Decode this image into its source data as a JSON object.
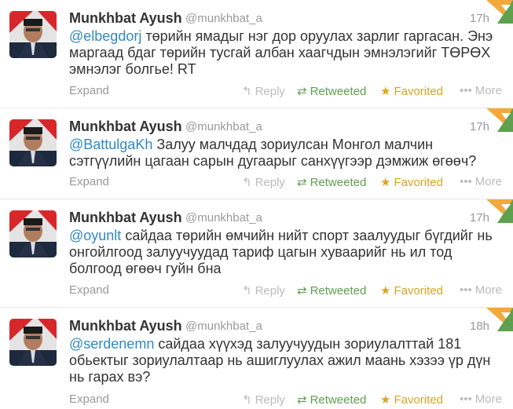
{
  "tweets": [
    {
      "name": "Munkhbat Ayush",
      "handle": "@munkhbat_a",
      "time": "17h",
      "mention": "@elbegdorj",
      "lines": [
        " төрийн ямадыг нэг дор оруулах зарлиг гаргасан. Энэ",
        "маргаад бдаг төрийн тусгай албан хаагчдын эмнэлэгийг ТӨРӨХ",
        "эмнэлэг болгье! RT"
      ],
      "expand": "Expand",
      "reply": "Reply",
      "retweet": "Retweeted",
      "favorite": "Favorited",
      "more": "More"
    },
    {
      "name": "Munkhbat Ayush",
      "handle": "@munkhbat_a",
      "time": "17h",
      "mention": "@BattulgaKh",
      "lines": [
        " Залуу малчдад зориулсан Монгол малчин",
        "сэтгүүлийн цагаан сарын дугаарыг санхүүгээр дэмжиж өгөөч?"
      ],
      "expand": "Expand",
      "reply": "Reply",
      "retweet": "Retweeted",
      "favorite": "Favorited",
      "more": "More"
    },
    {
      "name": "Munkhbat Ayush",
      "handle": "@munkhbat_a",
      "time": "17h",
      "mention": "@oyunlt",
      "lines": [
        " сайдаа төрийн өмчийн нийт спорт заалуудыг бүгдийг нь",
        "онгойлгоод залуучуудад тариф цагын хуваарийг нь ил тод",
        "болгоод өгөөч гуйн бна"
      ],
      "expand": "Expand",
      "reply": "Reply",
      "retweet": "Retweeted",
      "favorite": "Favorited",
      "more": "More"
    },
    {
      "name": "Munkhbat Ayush",
      "handle": "@munkhbat_a",
      "time": "18h",
      "mention": "@serdenemn",
      "lines": [
        " сайдаа хүүхэд залуучуудын зориулалттай 181",
        "обьектыг зориулалтаар нь ашиглуулах ажил маань хэзээ үр дүн",
        "нь гарах вэ?"
      ],
      "expand": "Expand",
      "reply": "Reply",
      "retweet": "Retweeted",
      "favorite": "Favorited",
      "more": "More"
    }
  ],
  "colors": {
    "mention": "#2f8ac3",
    "retweeted": "#5ea04e",
    "favorited": "#d8a426",
    "muted": "#999999"
  },
  "icons": {
    "reply": "reply-arrow-icon",
    "retweet": "retweet-icon",
    "favorite": "star-icon",
    "more": "dots-icon",
    "corner": "retweet-favorite-corner-icon"
  }
}
